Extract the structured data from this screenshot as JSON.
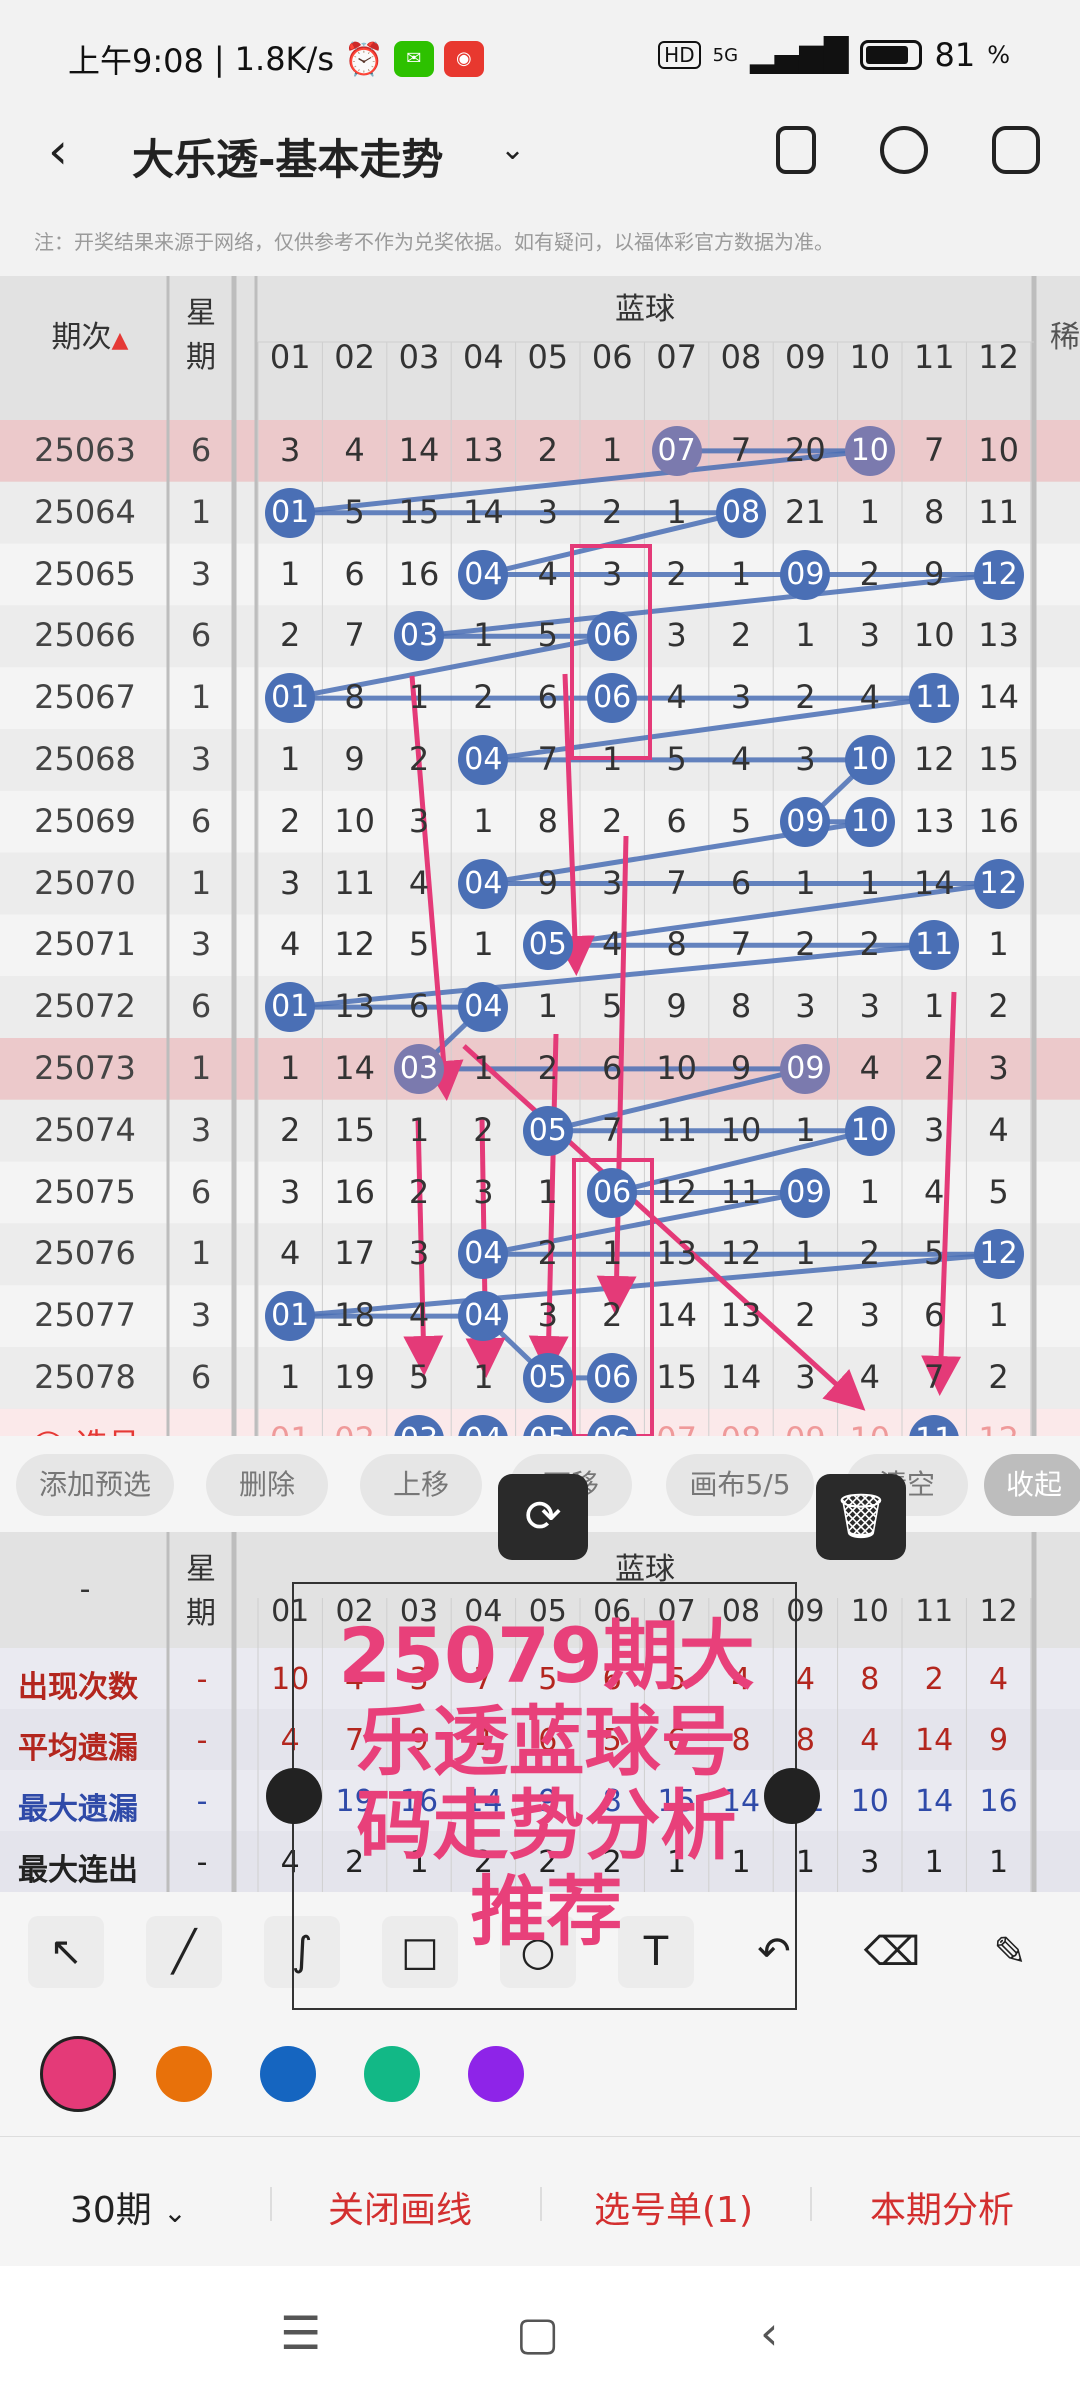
{
  "status_bar": {
    "time": "上午9:08",
    "speed": "1.8K/s",
    "network": "5G",
    "battery": "81"
  },
  "header": {
    "title": "大乐透-基本走势"
  },
  "notice": "注：开奖结果来源于网络，仅供参考不作为兑奖依据。如有疑问，以福体彩官方数据为准。",
  "table": {
    "col_issue": "期次",
    "col_week_1": "星",
    "col_week_2": "期",
    "group": "蓝球",
    "next_col": "稀",
    "numbers": [
      "01",
      "02",
      "03",
      "04",
      "05",
      "06",
      "07",
      "08",
      "09",
      "10",
      "11",
      "12"
    ],
    "rows": [
      {
        "issue": "25063",
        "week": "6",
        "cells": [
          "3",
          "4",
          "14",
          "13",
          "2",
          "1",
          "07",
          "7",
          "20",
          "10",
          "7",
          "10"
        ]
      },
      {
        "issue": "25064",
        "week": "1",
        "cells": [
          "01",
          "5",
          "15",
          "14",
          "3",
          "2",
          "1",
          "08",
          "21",
          "1",
          "8",
          "11"
        ]
      },
      {
        "issue": "25065",
        "week": "3",
        "cells": [
          "1",
          "6",
          "16",
          "04",
          "4",
          "3",
          "2",
          "1",
          "09",
          "2",
          "9",
          "12"
        ]
      },
      {
        "issue": "25066",
        "week": "6",
        "cells": [
          "2",
          "7",
          "03",
          "1",
          "5",
          "06",
          "3",
          "2",
          "1",
          "3",
          "10",
          "13"
        ]
      },
      {
        "issue": "25067",
        "week": "1",
        "cells": [
          "01",
          "8",
          "1",
          "2",
          "6",
          "06",
          "4",
          "3",
          "2",
          "4",
          "11",
          "14"
        ]
      },
      {
        "issue": "25068",
        "week": "3",
        "cells": [
          "1",
          "9",
          "2",
          "04",
          "7",
          "1",
          "5",
          "4",
          "3",
          "10",
          "12",
          "15"
        ]
      },
      {
        "issue": "25069",
        "week": "6",
        "cells": [
          "2",
          "10",
          "3",
          "1",
          "8",
          "2",
          "6",
          "5",
          "09",
          "10",
          "13",
          "16"
        ]
      },
      {
        "issue": "25070",
        "week": "1",
        "cells": [
          "3",
          "11",
          "4",
          "04",
          "9",
          "3",
          "7",
          "6",
          "1",
          "1",
          "14",
          "12"
        ]
      },
      {
        "issue": "25071",
        "week": "3",
        "cells": [
          "4",
          "12",
          "5",
          "1",
          "05",
          "4",
          "8",
          "7",
          "2",
          "2",
          "11",
          "1"
        ]
      },
      {
        "issue": "25072",
        "week": "6",
        "cells": [
          "01",
          "13",
          "6",
          "04",
          "1",
          "5",
          "9",
          "8",
          "3",
          "3",
          "1",
          "2"
        ]
      },
      {
        "issue": "25073",
        "week": "1",
        "cells": [
          "1",
          "14",
          "03",
          "1",
          "2",
          "6",
          "10",
          "9",
          "09",
          "4",
          "2",
          "3"
        ]
      },
      {
        "issue": "25074",
        "week": "3",
        "cells": [
          "2",
          "15",
          "1",
          "2",
          "05",
          "7",
          "11",
          "10",
          "1",
          "10",
          "3",
          "4"
        ]
      },
      {
        "issue": "25075",
        "week": "6",
        "cells": [
          "3",
          "16",
          "2",
          "3",
          "1",
          "06",
          "12",
          "11",
          "09",
          "1",
          "4",
          "5"
        ]
      },
      {
        "issue": "25076",
        "week": "1",
        "cells": [
          "4",
          "17",
          "3",
          "04",
          "2",
          "1",
          "13",
          "12",
          "1",
          "2",
          "5",
          "12"
        ]
      },
      {
        "issue": "25077",
        "week": "3",
        "cells": [
          "01",
          "18",
          "4",
          "04",
          "3",
          "2",
          "14",
          "13",
          "2",
          "3",
          "6",
          "1"
        ]
      },
      {
        "issue": "25078",
        "week": "6",
        "cells": [
          "1",
          "19",
          "5",
          "1",
          "05",
          "06",
          "15",
          "14",
          "3",
          "4",
          "7",
          "2"
        ]
      }
    ],
    "select_label": "选号",
    "select_row": [
      "01",
      "02",
      "03",
      "04",
      "05",
      "06",
      "07",
      "08",
      "09",
      "10",
      "11",
      "12"
    ]
  },
  "actions": [
    "添加预选",
    "删除",
    "上移",
    "下移",
    "画布5/5",
    "清空",
    "收起"
  ],
  "stats": {
    "dash": "-",
    "rows": [
      {
        "label": "出现次数",
        "color": "#b3261e",
        "sign": "-",
        "vals": [
          "10",
          "4",
          "3",
          "7",
          "5",
          "6",
          "5",
          "4",
          "4",
          "8",
          "2",
          "4"
        ]
      },
      {
        "label": "平均遗漏",
        "color": "#b3261e",
        "sign": "-",
        "vals": [
          "4",
          "7",
          "9",
          "4",
          "6",
          "5",
          "6",
          "8",
          "8",
          "4",
          "14",
          "9"
        ]
      },
      {
        "label": "最大遗漏",
        "color": "#2f4aa8",
        "sign": "-",
        "vals": [
          "5",
          "19",
          "16",
          "14",
          "9",
          "8",
          "15",
          "14",
          "21",
          "10",
          "14",
          "16"
        ]
      },
      {
        "label": "最大连出",
        "color": "#222",
        "sign": "-",
        "vals": [
          "4",
          "2",
          "1",
          "2",
          "2",
          "2",
          "1",
          "1",
          "1",
          "3",
          "1",
          "1"
        ]
      }
    ]
  },
  "overlay_text": [
    "25079期大",
    "乐透蓝球号",
    "码走势分析",
    "推荐"
  ],
  "palette": [
    "#e43a78",
    "#e8710a",
    "#1565c0",
    "#12b886",
    "#8e24e8"
  ],
  "bottom_bar": {
    "period": "30期",
    "close_line": "关闭画线",
    "pick_list": "选号单(1)",
    "analysis": "本期分析"
  },
  "icons": [
    "back-icon",
    "chevron-down-icon",
    "phone-icon",
    "share-icon",
    "settings-icon",
    "refresh-icon",
    "trash-icon",
    "arrow-tool-icon",
    "line-tool-icon",
    "curve-tool-icon",
    "rect-tool-icon",
    "circle-tool-icon",
    "text-tool-icon",
    "undo-icon",
    "eraser-icon",
    "clear-icon",
    "menu-icon",
    "home-icon",
    "nav-back-icon"
  ]
}
